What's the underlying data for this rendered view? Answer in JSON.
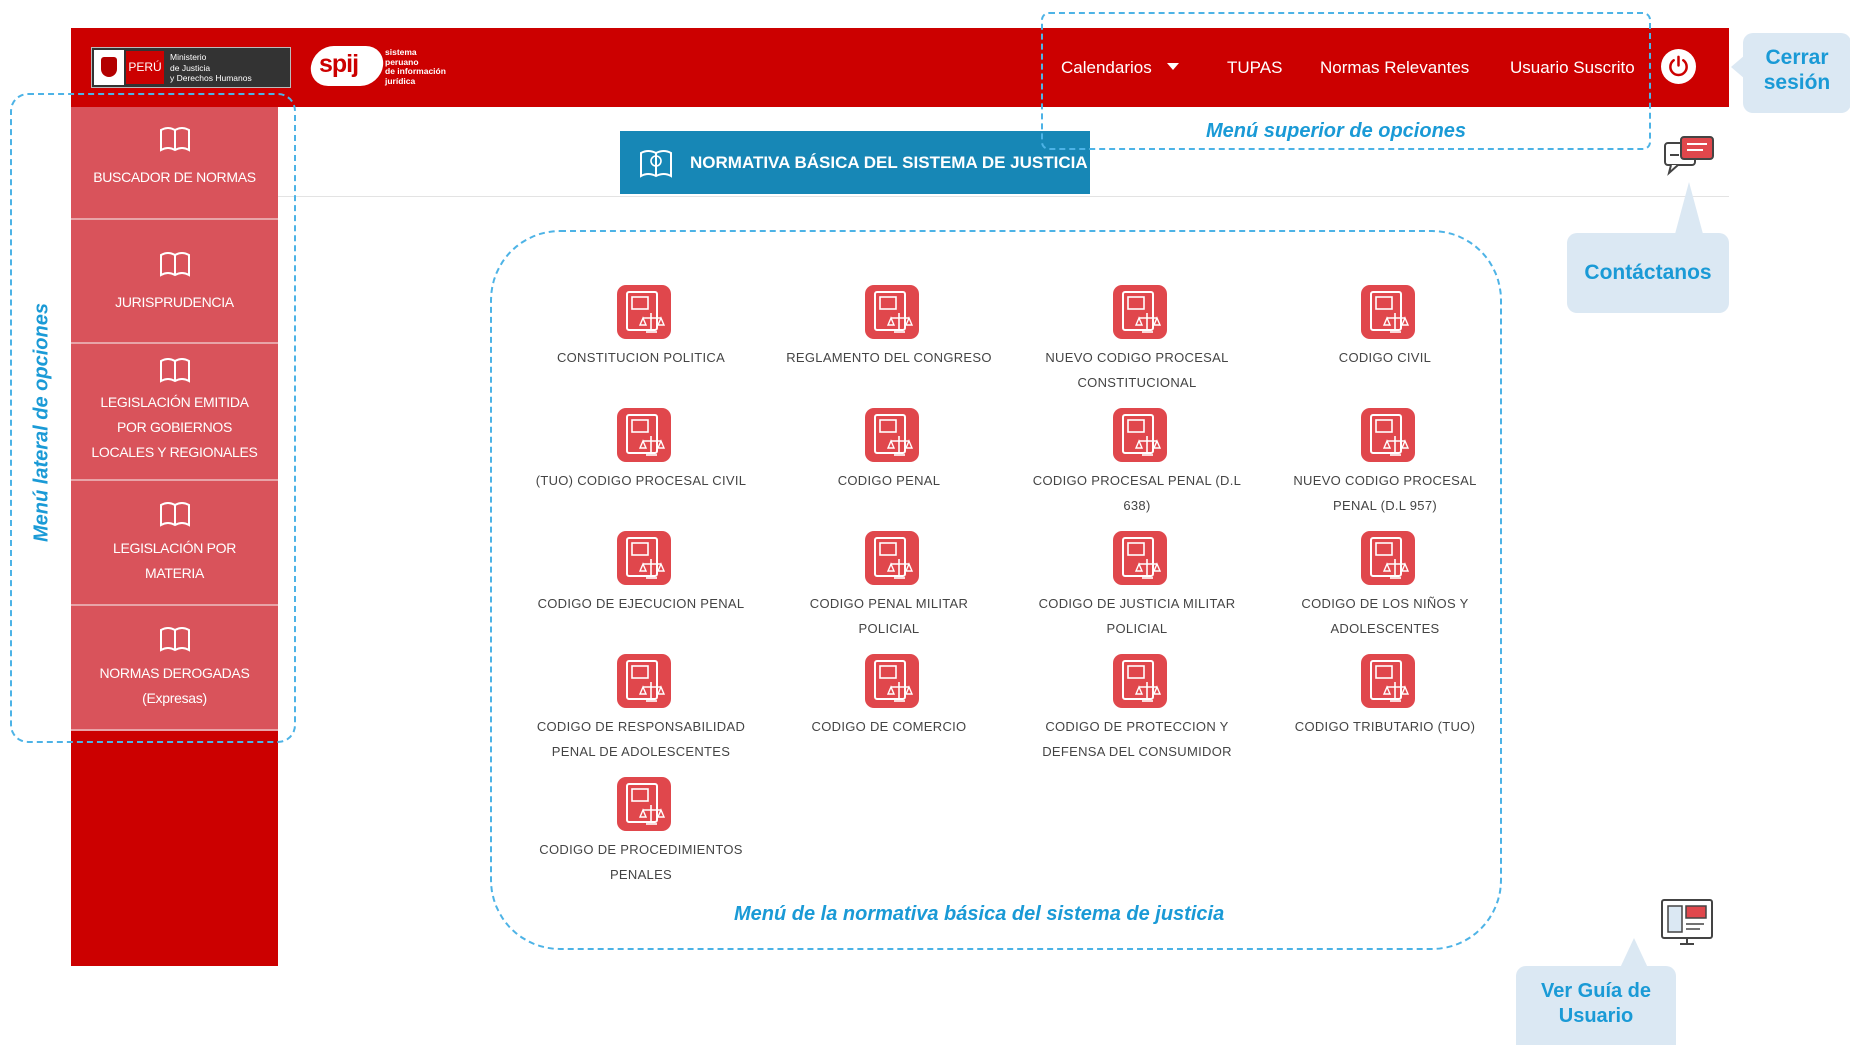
{
  "header": {
    "country": "PERÚ",
    "ministry": "Ministerio\nde Justicia\ny Derechos Humanos",
    "brand": "spij",
    "brand_tagline": "sistema\nperuano\nde información\njurídica",
    "nav": [
      {
        "label": "Calendarios",
        "has_dropdown": true
      },
      {
        "label": "TUPAS"
      },
      {
        "label": "Normas Relevantes"
      },
      {
        "label": "Usuario Suscrito"
      }
    ],
    "power_icon": "power-icon"
  },
  "page_title": "NORMATIVA BÁSICA DEL SISTEMA DE JUSTICIA",
  "sidebar": {
    "items": [
      {
        "label": "BUSCADOR DE NORMAS",
        "icon": "book-icon"
      },
      {
        "label": "JURISPRUDENCIA",
        "icon": "book-icon"
      },
      {
        "label": "LEGISLACIÓN EMITIDA\nPOR GOBIERNOS\nLOCALES Y REGIONALES",
        "icon": "book-icon"
      },
      {
        "label": "LEGISLACIÓN POR\nMATERIA",
        "icon": "book-icon"
      },
      {
        "label": "NORMAS DEROGADAS\n(Expresas)",
        "icon": "book-icon"
      }
    ]
  },
  "laws": [
    {
      "label": "CONSTITUCION POLITICA"
    },
    {
      "label": "REGLAMENTO DEL CONGRESO"
    },
    {
      "label": "NUEVO CODIGO PROCESAL\nCONSTITUCIONAL"
    },
    {
      "label": "CODIGO CIVIL"
    },
    {
      "label": "(TUO) CODIGO PROCESAL CIVIL"
    },
    {
      "label": "CODIGO PENAL"
    },
    {
      "label": "CODIGO PROCESAL PENAL (D.L\n638)"
    },
    {
      "label": "NUEVO CODIGO PROCESAL\nPENAL (D.L 957)"
    },
    {
      "label": "CODIGO DE EJECUCION PENAL"
    },
    {
      "label": "CODIGO PENAL MILITAR\nPOLICIAL"
    },
    {
      "label": "CODIGO DE JUSTICIA MILITAR\nPOLICIAL"
    },
    {
      "label": "CODIGO DE LOS NIÑOS Y\nADOLESCENTES"
    },
    {
      "label": "CODIGO DE RESPONSABILIDAD\nPENAL DE ADOLESCENTES"
    },
    {
      "label": "CODIGO DE COMERCIO"
    },
    {
      "label": "CODIGO DE PROTECCION Y\nDEFENSA DEL CONSUMIDOR"
    },
    {
      "label": "CODIGO TRIBUTARIO (TUO)"
    },
    {
      "label": "CODIGO DE PROCEDIMIENTOS\nPENALES"
    }
  ],
  "annotations": {
    "top_menu": "Menú superior de opciones",
    "side_menu": "Menú lateral de opciones",
    "main_menu": "Menú de la normativa básica del sistema de justicia",
    "logout": "Cerrar\nsesión",
    "contact": "Contáctanos",
    "guide": "Ver Guía de\nUsuario"
  },
  "colors": {
    "header_red": "#cc0000",
    "sidebar_item": "#d9535b",
    "title_blue": "#1787b6",
    "annotation_blue": "#1a9ad6",
    "annotation_bg": "#dbe8f3",
    "law_icon_red": "#e0474c"
  }
}
